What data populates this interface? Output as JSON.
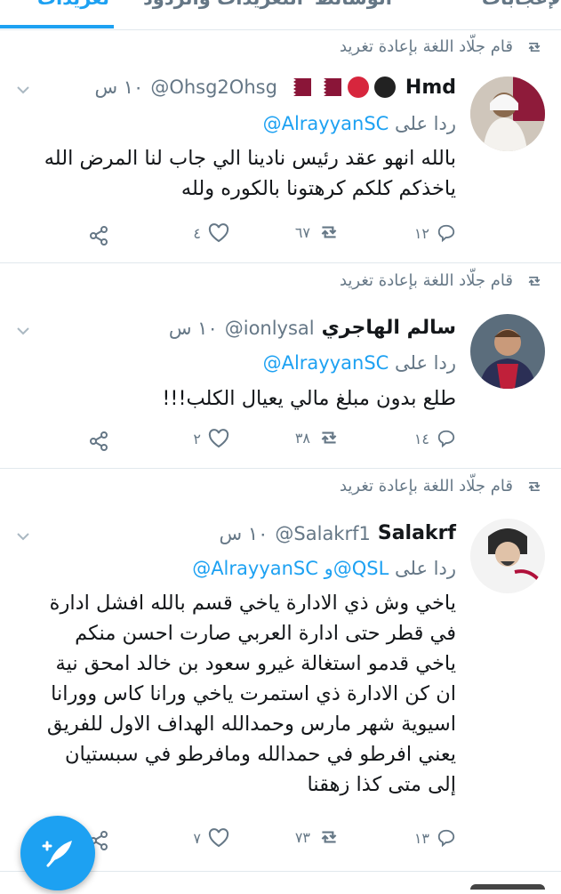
{
  "tabs": [
    {
      "label": "الإعجابات"
    },
    {
      "label": "الوسائط"
    },
    {
      "label": "التغريدات والردود"
    },
    {
      "label": "تغريدات"
    }
  ],
  "tweets": [
    {
      "retweet_text": "قام جلّاد اللغة بإعادة تغريد",
      "name": "Hmd",
      "handle": "@Ohsg2Ohsg",
      "time": "١٠ س",
      "reply_prefix": "ردا على",
      "reply_handles": "@AlrayyanSC",
      "text": [
        "بالله انهو عقد رئيس نادينا الي جاب لنا المرض الله",
        "ياخذكم كلكم كرهتونا بالكوره ولله"
      ],
      "replies": "١٢",
      "retweets": "٦٧",
      "likes": "٤"
    },
    {
      "retweet_text": "قام جلّاد اللغة بإعادة تغريد",
      "name": "سالم الهاجري",
      "handle": "@ionlysal",
      "time": "١٠ س",
      "reply_prefix": "ردا على",
      "reply_handles": "@AlrayyanSC",
      "text": [
        "طلع بدون مبلغ مالي يعيال الكلب!!!"
      ],
      "replies": "١٤",
      "retweets": "٣٨",
      "likes": "٢"
    },
    {
      "retweet_text": "قام جلّاد اللغة بإعادة تغريد",
      "name": "Salakrf",
      "handle": "@Salakrf1",
      "time": "١٠ س",
      "reply_prefix": "ردا على",
      "reply_handles": "@AlrayyanSC و@QSL",
      "text": [
        "ياخي وش ذي الادارة ياخي قسم بالله افشل ادارة",
        "في قطر حتى ادارة العربي صارت احسن منكم",
        "ياخي قدمو استغالة غيرو سعود بن خالد امحق نية",
        "ان كن الادارة ذي استمرت ياخي ورانا كاس وورانا",
        "اسيوية شهر مارس وحمدالله الهداف الاول للفريق",
        "يعني افرطو في حمدالله ومافرطو في سبستيان",
        "إلى متى كذا زهقنا"
      ],
      "replies": "١٣",
      "retweets": "٧٣",
      "likes": "٧"
    }
  ],
  "colors": {
    "accent": "#1da1f2",
    "muted": "#657786",
    "text": "#14171a"
  }
}
